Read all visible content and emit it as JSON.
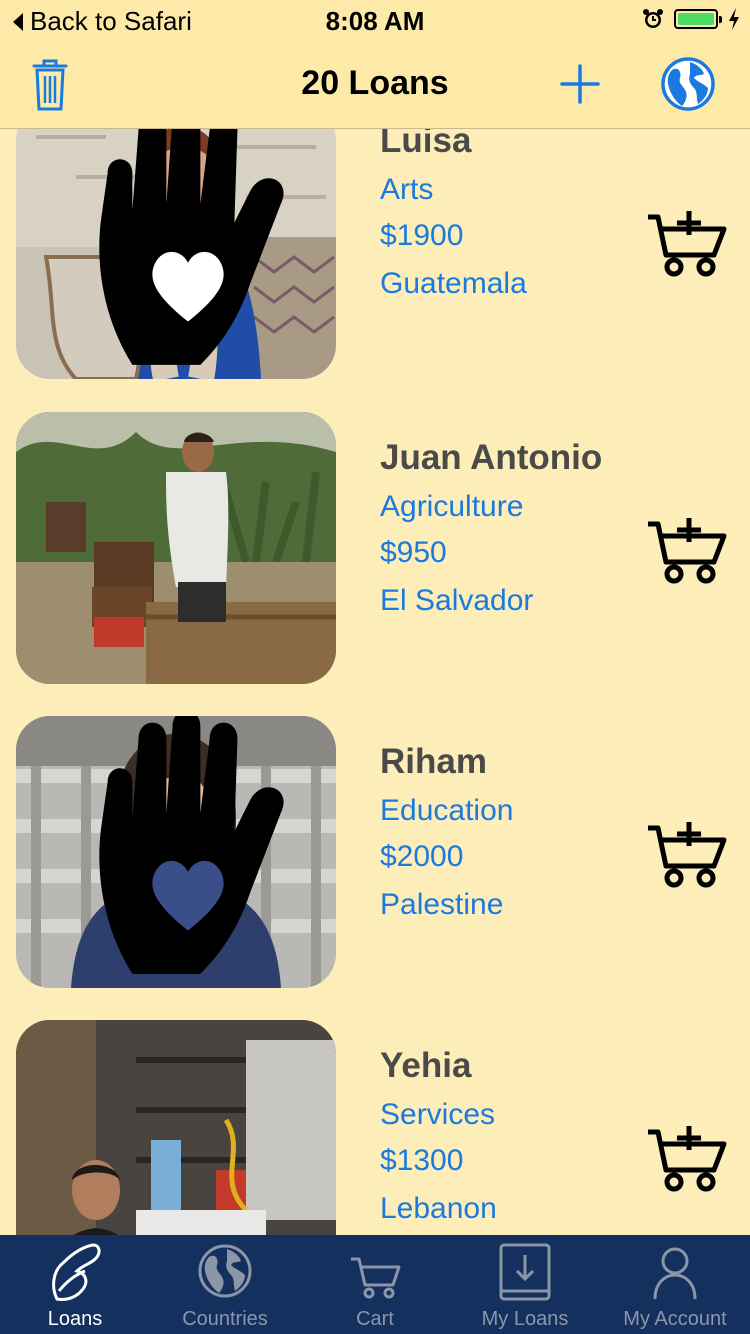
{
  "status_bar": {
    "back_label": "Back to Safari",
    "time": "8:08 AM"
  },
  "nav": {
    "title": "20 Loans",
    "accent_color": "#1a7ae0"
  },
  "loans": [
    {
      "name": "Luisa",
      "sector": "Arts",
      "amount": "$1900",
      "country": "Guatemala",
      "has_badge": true
    },
    {
      "name": "Juan Antonio",
      "sector": "Agriculture",
      "amount": "$950",
      "country": "El Salvador",
      "has_badge": false
    },
    {
      "name": "Riham",
      "sector": "Education",
      "amount": "$2000",
      "country": "Palestine",
      "has_badge": true
    },
    {
      "name": "Yehia",
      "sector": "Services",
      "amount": "$1300",
      "country": "Lebanon",
      "has_badge": false
    }
  ],
  "tabs": [
    {
      "label": "Loans",
      "icon": "loans-icon",
      "active": true
    },
    {
      "label": "Countries",
      "icon": "globe-icon",
      "active": false
    },
    {
      "label": "Cart",
      "icon": "cart-icon",
      "active": false
    },
    {
      "label": "My Loans",
      "icon": "my-loans-icon",
      "active": false
    },
    {
      "label": "My Account",
      "icon": "account-icon",
      "active": false
    }
  ],
  "colors": {
    "background": "#fdedb8",
    "tab_bar": "#14305e",
    "name_text": "#4a4a4a",
    "link_text": "#1a7ae0"
  }
}
